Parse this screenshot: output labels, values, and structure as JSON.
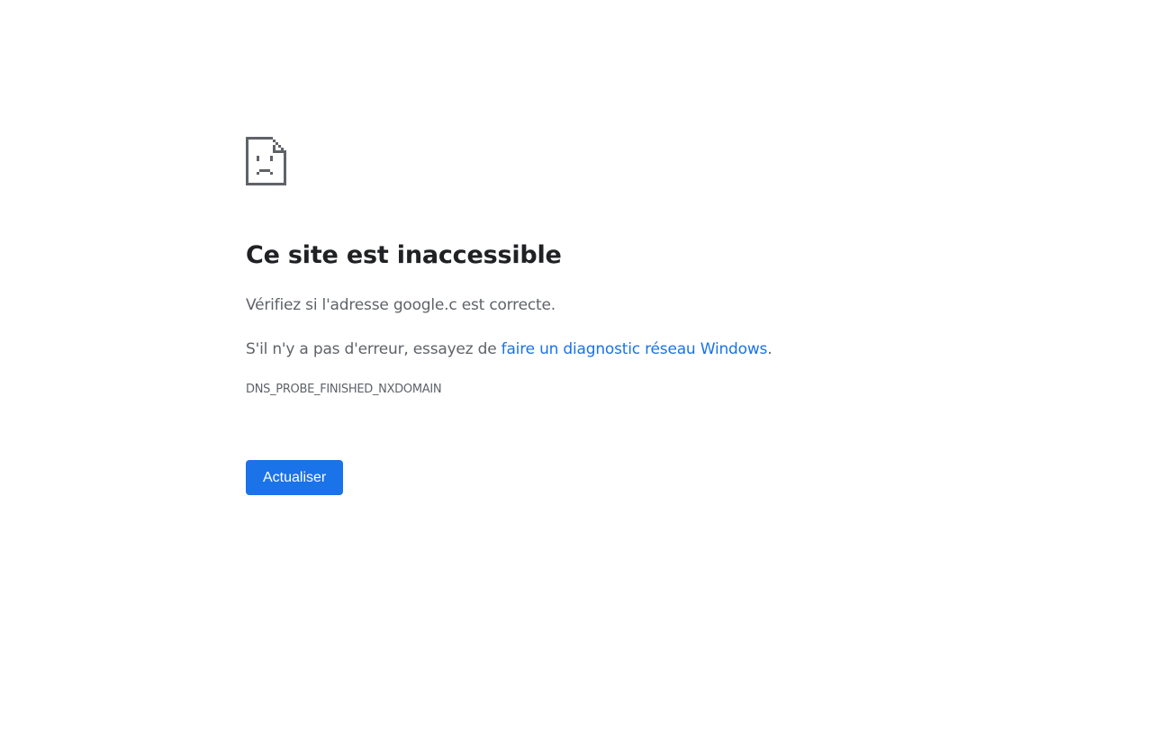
{
  "error": {
    "icon": "sad-page-icon",
    "title": "Ce site est inaccessible",
    "message_1": "Vérifiez si l'adresse google.c est correcte.",
    "message_2_prefix": "S'il n'y a pas d'erreur, essayez de ",
    "message_2_link": "faire un diagnostic réseau Windows",
    "message_2_suffix": ".",
    "error_code": "DNS_PROBE_FINISHED_NXDOMAIN",
    "reload_label": "Actualiser"
  },
  "colors": {
    "title": "#202124",
    "text": "#5f6368",
    "link": "#1a73e8",
    "button_bg": "#1a73e8",
    "icon": "#5f6368"
  }
}
